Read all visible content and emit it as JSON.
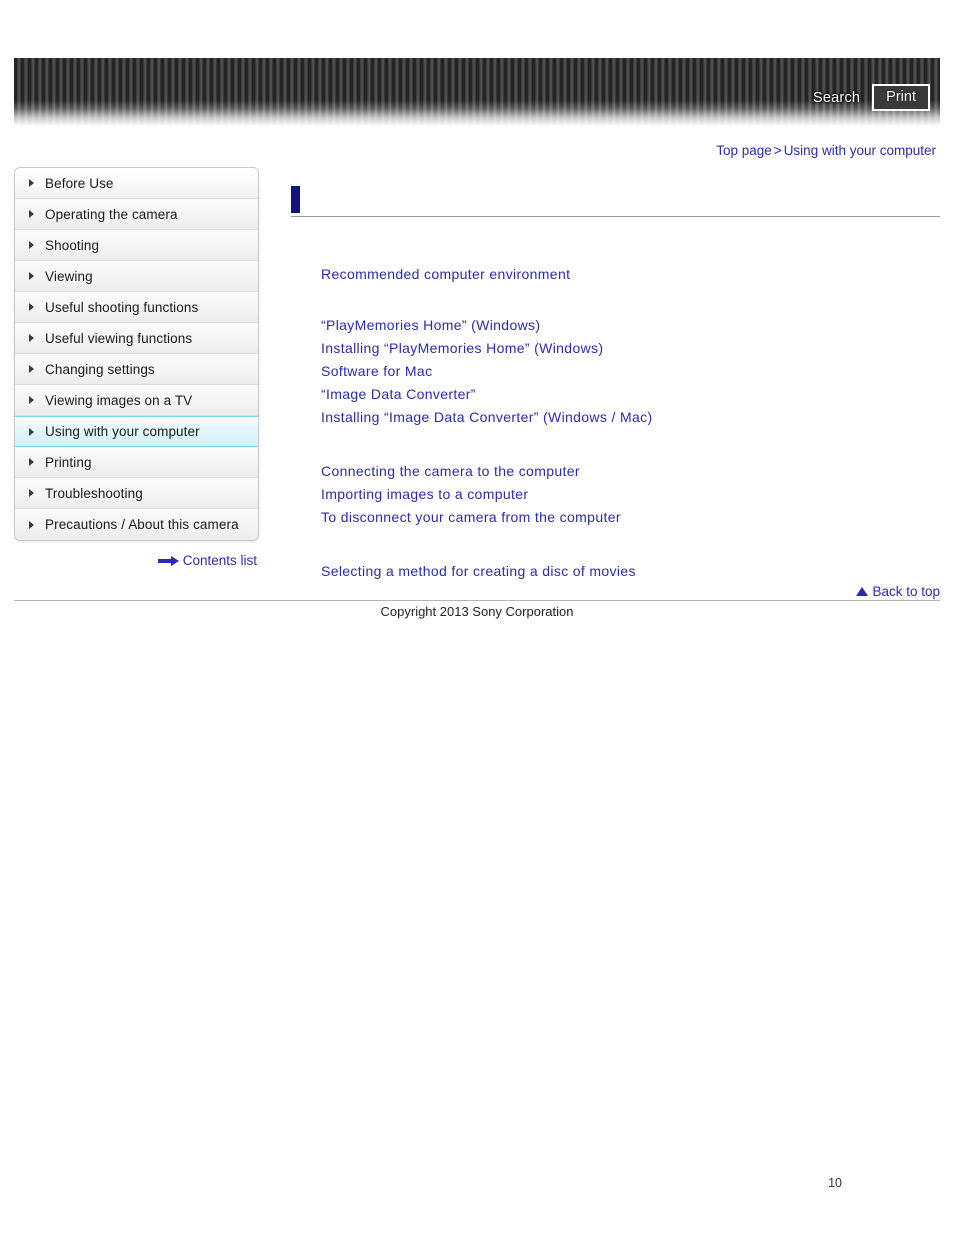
{
  "header": {
    "search_label": "Search",
    "print_label": "Print",
    "search_icon": "search-icon",
    "print_icon": "print-icon"
  },
  "breadcrumb": {
    "top_page": "Top page",
    "separator": ">",
    "current": "Using with your computer"
  },
  "sidebar": {
    "items": [
      {
        "label": "Before Use",
        "active": false
      },
      {
        "label": "Operating the camera",
        "active": false
      },
      {
        "label": "Shooting",
        "active": false
      },
      {
        "label": "Viewing",
        "active": false
      },
      {
        "label": "Useful shooting functions",
        "active": false
      },
      {
        "label": "Useful viewing functions",
        "active": false
      },
      {
        "label": "Changing settings",
        "active": false
      },
      {
        "label": "Viewing images on a TV",
        "active": false
      },
      {
        "label": "Using with your computer",
        "active": true
      },
      {
        "label": "Printing",
        "active": false
      },
      {
        "label": "Troubleshooting",
        "active": false
      },
      {
        "label": "Precautions / About this camera",
        "active": false
      }
    ],
    "contents_list_label": "Contents list",
    "contents_list_icon": "arrow-right-icon"
  },
  "main": {
    "page_title": "",
    "groups": [
      {
        "links": [
          "Recommended computer environment"
        ]
      },
      {
        "links": [
          "“PlayMemories Home” (Windows)",
          "Installing “PlayMemories Home” (Windows)",
          "Software for Mac",
          "“Image Data Converter”",
          "Installing “Image Data Converter” (Windows / Mac)"
        ]
      },
      {
        "links": [
          "Connecting the camera to the computer",
          "Importing images to a computer",
          "To disconnect your camera from the computer"
        ]
      },
      {
        "links": [
          "Selecting a method for creating a disc of movies"
        ]
      }
    ]
  },
  "footer": {
    "back_to_top_label": "Back to top",
    "back_to_top_icon": "triangle-up-icon",
    "copyright": "Copyright 2013 Sony Corporation",
    "page_number": "10"
  },
  "colors": {
    "link": "#2b2bb0",
    "title_marker": "#12137f",
    "active_nav_bg": "#d3f0fa",
    "active_nav_border": "#7fd3ea"
  }
}
